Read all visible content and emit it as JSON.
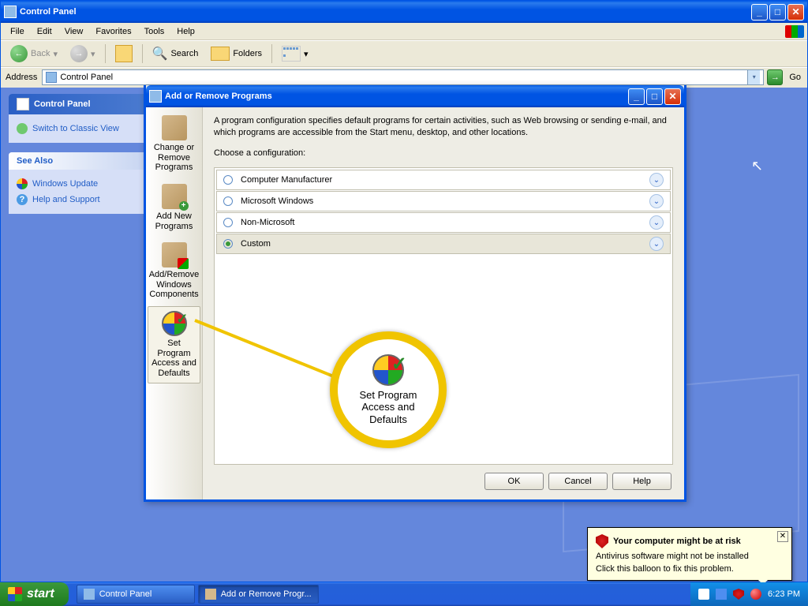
{
  "parent": {
    "title": "Control Panel",
    "menu": [
      "File",
      "Edit",
      "View",
      "Favorites",
      "Tools",
      "Help"
    ],
    "toolbar": {
      "back": "Back",
      "search": "Search",
      "folders": "Folders"
    },
    "address": {
      "label": "Address",
      "value": "Control Panel",
      "go": "Go"
    },
    "side": {
      "panel_title": "Control Panel",
      "switch": "Switch to Classic View",
      "see_also": "See Also",
      "win_update": "Windows Update",
      "help": "Help and Support"
    }
  },
  "dialog": {
    "title": "Add or Remove Programs",
    "sidebar": [
      "Change or Remove Programs",
      "Add New Programs",
      "Add/Remove Windows Components",
      "Set Program Access and Defaults"
    ],
    "desc": "A program configuration specifies default programs for certain activities, such as Web browsing or sending e-mail, and which programs are accessible from the Start menu, desktop, and other locations.",
    "choose": "Choose a configuration:",
    "configs": [
      "Computer Manufacturer",
      "Microsoft Windows",
      "Non-Microsoft",
      "Custom"
    ],
    "selected": "Custom",
    "buttons": {
      "ok": "OK",
      "cancel": "Cancel",
      "help": "Help"
    }
  },
  "callout": {
    "text": "Set Program Access and Defaults"
  },
  "balloon": {
    "title": "Your computer might be at risk",
    "line1": "Antivirus software might not be installed",
    "line2": "Click this balloon to fix this problem."
  },
  "taskbar": {
    "start": "start",
    "items": [
      "Control Panel",
      "Add or Remove Progr..."
    ],
    "clock": "6:23 PM"
  }
}
